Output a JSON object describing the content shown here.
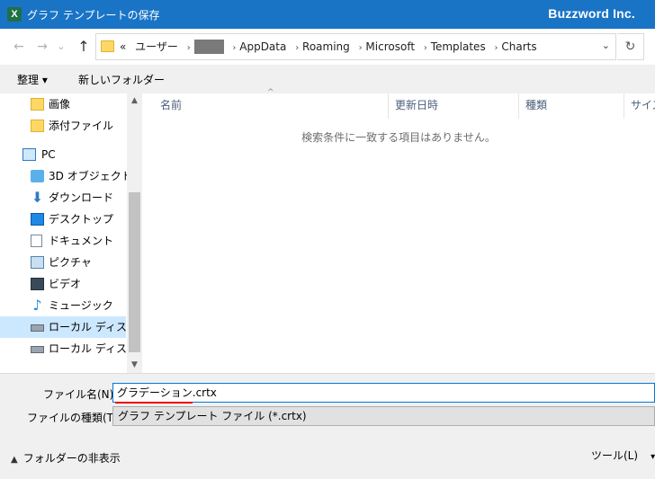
{
  "window": {
    "title": "グラフ テンプレートの保存",
    "app_icon_letter": "X",
    "brand": "Buzzword Inc."
  },
  "nav": {
    "back_glyph": "←",
    "forward_glyph": "→",
    "recent_glyph": "⌄",
    "up_glyph": "↑",
    "address": {
      "prefix": "«",
      "segments": [
        "ユーザー",
        "",
        "AppData",
        "Roaming",
        "Microsoft",
        "Templates",
        "Charts"
      ],
      "separator": "›"
    },
    "dropdown_glyph": "⌄",
    "refresh_glyph": "↻"
  },
  "toolbar": {
    "organize": "整理 ▾",
    "new_folder": "新しいフォルダー"
  },
  "sidebar": {
    "items": [
      {
        "label": "画像",
        "icon": "folder-icon"
      },
      {
        "label": "添付ファイル",
        "icon": "folder-icon"
      },
      {
        "label": "PC",
        "icon": "pc-icon"
      },
      {
        "label": "3D オブジェクト",
        "icon": "3d-objects-icon"
      },
      {
        "label": "ダウンロード",
        "icon": "download-icon"
      },
      {
        "label": "デスクトップ",
        "icon": "desktop-icon"
      },
      {
        "label": "ドキュメント",
        "icon": "document-icon"
      },
      {
        "label": "ピクチャ",
        "icon": "pictures-icon"
      },
      {
        "label": "ビデオ",
        "icon": "video-icon"
      },
      {
        "label": "ミュージック",
        "icon": "music-icon"
      },
      {
        "label": "ローカル ディスク (C",
        "icon": "disk-icon"
      },
      {
        "label": "ローカル ディスク (D",
        "icon": "disk-icon"
      }
    ],
    "selected_index": 10
  },
  "columns": {
    "name": "名前",
    "modified": "更新日時",
    "type": "種類",
    "size": "サイズ"
  },
  "content": {
    "empty_message": "検索条件に一致する項目はありません。"
  },
  "save_form": {
    "filename_label": "ファイル名(N):",
    "filename_value": "グラデーション.crtx",
    "filetype_label": "ファイルの種類(T):",
    "filetype_value": "グラフ テンプレート ファイル (*.crtx)"
  },
  "footer": {
    "hide_folders": "フォルダーの非表示",
    "tools": "ツール(L)",
    "tools_glyph": "▾",
    "hide_glyph": "▲"
  },
  "colors": {
    "titlebar": "#1a74c6",
    "selected": "#cce8ff",
    "underline": "#e60000"
  }
}
